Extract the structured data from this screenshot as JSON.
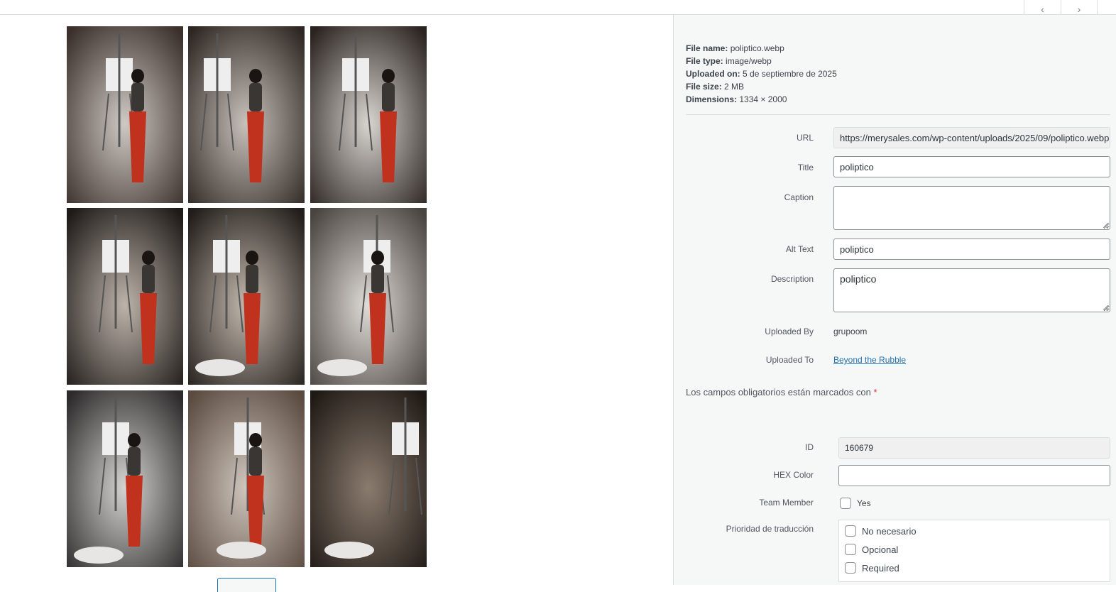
{
  "details": {
    "file_name_label": "File name:",
    "file_name": "poliptico.webp",
    "file_type_label": "File type:",
    "file_type": "image/webp",
    "uploaded_on_label": "Uploaded on:",
    "uploaded_on": "5 de septiembre de 2025",
    "file_size_label": "File size:",
    "file_size": "2 MB",
    "dimensions_label": "Dimensions:",
    "dimensions": "1334 × 2000"
  },
  "fields": {
    "url_label": "URL",
    "url_value": "https://merysales.com/wp-content/uploads/2025/09/poliptico.webp",
    "title_label": "Title",
    "title_value": "poliptico",
    "caption_label": "Caption",
    "caption_value": "",
    "alt_label": "Alt Text",
    "alt_value": "poliptico",
    "description_label": "Description",
    "description_value": "poliptico",
    "uploaded_by_label": "Uploaded By",
    "uploaded_by_value": "grupoom",
    "uploaded_to_label": "Uploaded To",
    "uploaded_to_value": "Beyond the Rubble"
  },
  "required_note": "Los campos obligatorios están marcados con",
  "required_star": "*",
  "custom": {
    "id_label": "ID",
    "id_value": "160679",
    "hex_label": "HEX Color",
    "hex_value": "",
    "team_label": "Team Member",
    "team_option": "Yes",
    "priority_label": "Prioridad de traducción",
    "priority_options": [
      "No necesario",
      "Opcional",
      "Required"
    ]
  },
  "nav": {
    "prev_icon": "chevron-left-icon",
    "next_icon": "chevron-right-icon"
  }
}
